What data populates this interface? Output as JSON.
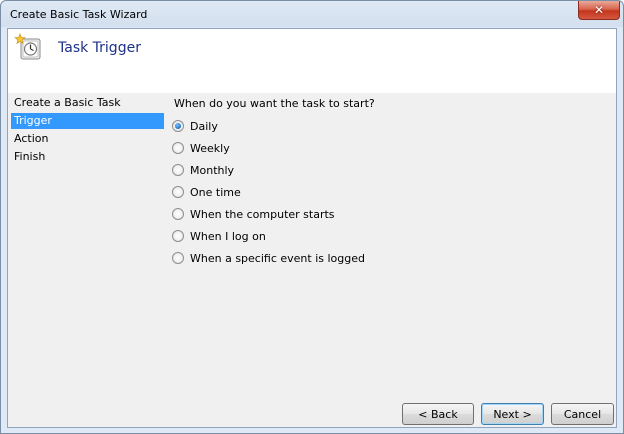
{
  "window": {
    "title": "Create Basic Task Wizard",
    "close_glyph": "✕"
  },
  "header": {
    "title": "Task Trigger",
    "icon": "task-scheduler-clock-icon"
  },
  "steps": [
    {
      "label": "Create a Basic Task",
      "selected": false
    },
    {
      "label": "Trigger",
      "selected": true
    },
    {
      "label": "Action",
      "selected": false
    },
    {
      "label": "Finish",
      "selected": false
    }
  ],
  "content": {
    "question": "When do you want the task to start?",
    "options": [
      {
        "label": "Daily",
        "checked": true
      },
      {
        "label": "Weekly",
        "checked": false
      },
      {
        "label": "Monthly",
        "checked": false
      },
      {
        "label": "One time",
        "checked": false
      },
      {
        "label": "When the computer starts",
        "checked": false
      },
      {
        "label": "When I log on",
        "checked": false
      },
      {
        "label": "When a specific event is logged",
        "checked": false
      }
    ]
  },
  "buttons": {
    "back": "< Back",
    "next": "Next >",
    "cancel": "Cancel"
  },
  "colors": {
    "selection": "#3399ff",
    "header_title": "#1e3287",
    "close_button": "#c3361f"
  }
}
